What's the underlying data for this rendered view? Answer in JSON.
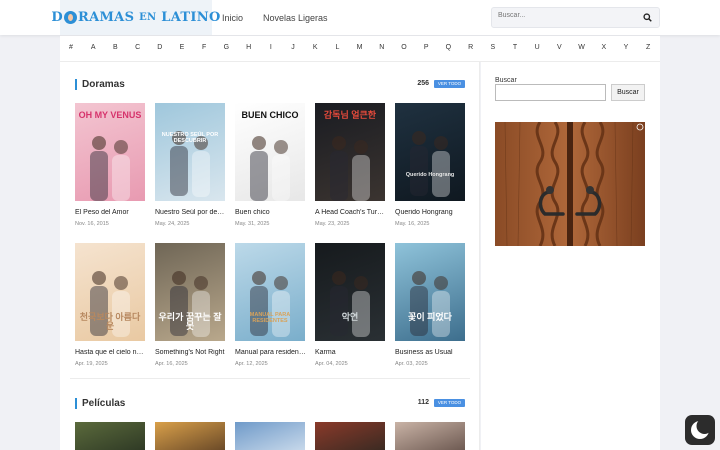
{
  "header": {
    "logo_pre": "D",
    "logo_mid": "RAMAS",
    "logo_en": "EN",
    "logo_post": "LATINO",
    "nav": [
      "Inicio",
      "Novelas Ligeras"
    ],
    "search_placeholder": "Buscar..."
  },
  "alphabet": [
    "#",
    "A",
    "B",
    "C",
    "D",
    "E",
    "F",
    "G",
    "H",
    "I",
    "J",
    "K",
    "L",
    "M",
    "N",
    "O",
    "P",
    "Q",
    "R",
    "S",
    "T",
    "U",
    "V",
    "W",
    "X",
    "Y",
    "Z"
  ],
  "doramas": {
    "title": "Doramas",
    "count": "256",
    "view_all": "VER TODO",
    "items": [
      {
        "title": "El Peso del Amor",
        "date": "Nov. 16, 2015",
        "poster_text": "OH MY VENUS",
        "c1": "#f3c5d1",
        "c2": "#e89ab1",
        "tc": "#d6336c"
      },
      {
        "title": "Nuestro Seúl por de…",
        "date": "May. 24, 2025",
        "poster_text": "NUESTRO SEÚL POR DESCUBRIR",
        "c1": "#9fc7dc",
        "c2": "#d9e6ee",
        "tc": "#ffffff"
      },
      {
        "title": "Buen chico",
        "date": "May. 31, 2025",
        "poster_text": "BUEN CHICO",
        "c1": "#ffffff",
        "c2": "#e7e7e7",
        "tc": "#111111"
      },
      {
        "title": "A Head Coach's Turn…",
        "date": "May. 23, 2025",
        "poster_text": "감독님 얼큰한",
        "c1": "#1a1c22",
        "c2": "#3b3430",
        "tc": "#e84b3c"
      },
      {
        "title": "Querido Hongrang",
        "date": "May. 16, 2025",
        "poster_text": "Querido Hongrang",
        "c1": "#1f3140",
        "c2": "#0f1820",
        "tc": "#e6e6e6"
      },
      {
        "title": "Hasta que el cielo n…",
        "date": "Apr. 19, 2025",
        "poster_text": "천국보다 아름다운",
        "c1": "#f5e3cf",
        "c2": "#e9c9a2",
        "tc": "#b7885f"
      },
      {
        "title": "Something's Not Right",
        "date": "Apr. 16, 2025",
        "poster_text": "우리가 꿈꾸는 잘못",
        "c1": "#6f6656",
        "c2": "#b9a88c",
        "tc": "#ffffff"
      },
      {
        "title": "Manual para residen…",
        "date": "Apr. 12, 2025",
        "poster_text": "MANUAL PARA RESIDENTES",
        "c1": "#bcd9e9",
        "c2": "#7aaecb",
        "tc": "#d8a25a"
      },
      {
        "title": "Karma",
        "date": "Apr. 04, 2025",
        "poster_text": "악연",
        "c1": "#161a1d",
        "c2": "#2a3034",
        "tc": "#cfd6d9"
      },
      {
        "title": "Business as Usual",
        "date": "Apr. 03, 2025",
        "poster_text": "꽃이 피었다",
        "c1": "#8fc3da",
        "c2": "#3d6e8d",
        "tc": "#ffffff"
      }
    ]
  },
  "peliculas": {
    "title": "Películas",
    "count": "112",
    "view_all": "VER TODO",
    "thumbs": [
      {
        "c1": "#5b6a3c",
        "c2": "#2f3a25"
      },
      {
        "c1": "#d9a04a",
        "c2": "#6b4a28"
      },
      {
        "c1": "#6f9ac9",
        "c2": "#c7d8ea"
      },
      {
        "c1": "#8a3a2a",
        "c2": "#3b2a22"
      },
      {
        "c1": "#c9b3a6",
        "c2": "#6e5a52"
      }
    ]
  },
  "sidebar": {
    "search_label": "Buscar",
    "search_button": "Buscar"
  }
}
